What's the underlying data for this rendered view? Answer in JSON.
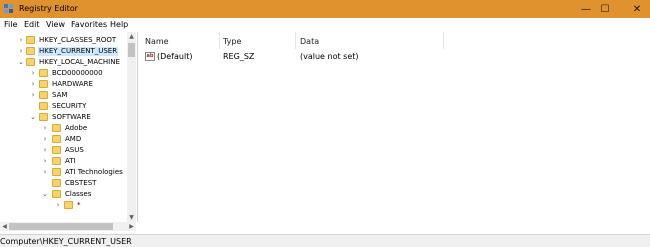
{
  "window": {
    "title": "Registry Editor",
    "minimize_glyph": "—",
    "maximize_glyph": "☐",
    "close_glyph": "✕",
    "titlebar_color": "#e0922e"
  },
  "menu": [
    "File",
    "Edit",
    "View",
    "Favorites",
    "Help"
  ],
  "tree": [
    {
      "label": "HKEY_CLASSES_ROOT",
      "expander": "›",
      "selected": false
    },
    {
      "label": "HKEY_CURRENT_USER",
      "expander": "›",
      "selected": true
    },
    {
      "label": "HKEY_LOCAL_MACHINE",
      "expander": "⌄",
      "selected": false
    },
    {
      "label": "BCD00000000",
      "expander": "›",
      "selected": false
    },
    {
      "label": "HARDWARE",
      "expander": "›",
      "selected": false
    },
    {
      "label": "SAM",
      "expander": "›",
      "selected": false
    },
    {
      "label": "SECURITY",
      "expander": "",
      "selected": false
    },
    {
      "label": "SOFTWARE",
      "expander": "⌄",
      "selected": false
    },
    {
      "label": "Adobe",
      "expander": "›",
      "selected": false
    },
    {
      "label": "AMD",
      "expander": "›",
      "selected": false
    },
    {
      "label": "ASUS",
      "expander": "›",
      "selected": false
    },
    {
      "label": "ATI",
      "expander": "›",
      "selected": false
    },
    {
      "label": "ATI Technologies",
      "expander": "›",
      "selected": false
    },
    {
      "label": "CBSTEST",
      "expander": "",
      "selected": false
    },
    {
      "label": "Classes",
      "expander": "⌄",
      "selected": false
    },
    {
      "label": "*",
      "expander": "›",
      "selected": false
    }
  ],
  "list": {
    "columns": [
      "Name",
      "Type",
      "Data"
    ],
    "rows": [
      {
        "name": "(Default)",
        "type": "REG_SZ",
        "data": "(value not set)",
        "icon": "string-value-icon",
        "icon_text": "ab"
      }
    ]
  },
  "status": {
    "path": "Computer\\HKEY_CURRENT_USER"
  },
  "scroll": {
    "up": "▲",
    "down": "▼",
    "left": "◀",
    "right": "▶"
  }
}
